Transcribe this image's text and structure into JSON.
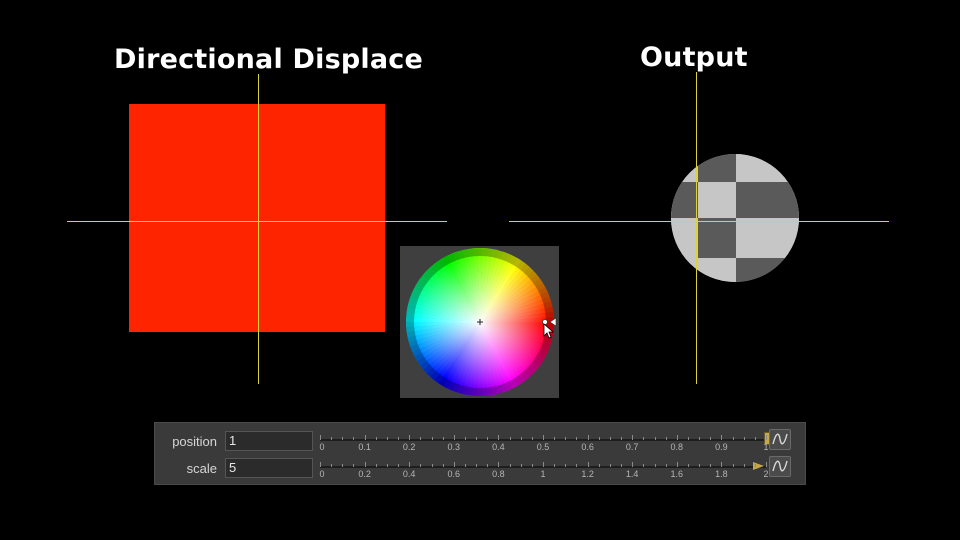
{
  "viewers": {
    "left_title": "Directional Displace",
    "right_title": "Output"
  },
  "colors": {
    "crosshair": "#d9d433",
    "red_square": "#ff2400",
    "checker_light": "#c6c6c6",
    "checker_dark": "#5a5a5a"
  },
  "parameters": [
    {
      "label": "position",
      "value": "1",
      "ticks": [
        "0",
        "0.1",
        "0.2",
        "0.3",
        "0.4",
        "0.5",
        "0.6",
        "0.7",
        "0.8",
        "0.9",
        "1"
      ],
      "min": 0,
      "max": 1,
      "current": 1
    },
    {
      "label": "scale",
      "value": "5",
      "ticks": [
        "0",
        "0.2",
        "0.4",
        "0.6",
        "0.8",
        "1",
        "1.2",
        "1.4",
        "1.6",
        "1.8",
        "2"
      ],
      "min": 0,
      "max": 2,
      "current": 2
    }
  ],
  "icons": {
    "curve_button": "curve-icon",
    "wheel_cursor": "cursor-arrow-icon",
    "wheel_center": "crosshair-icon"
  }
}
